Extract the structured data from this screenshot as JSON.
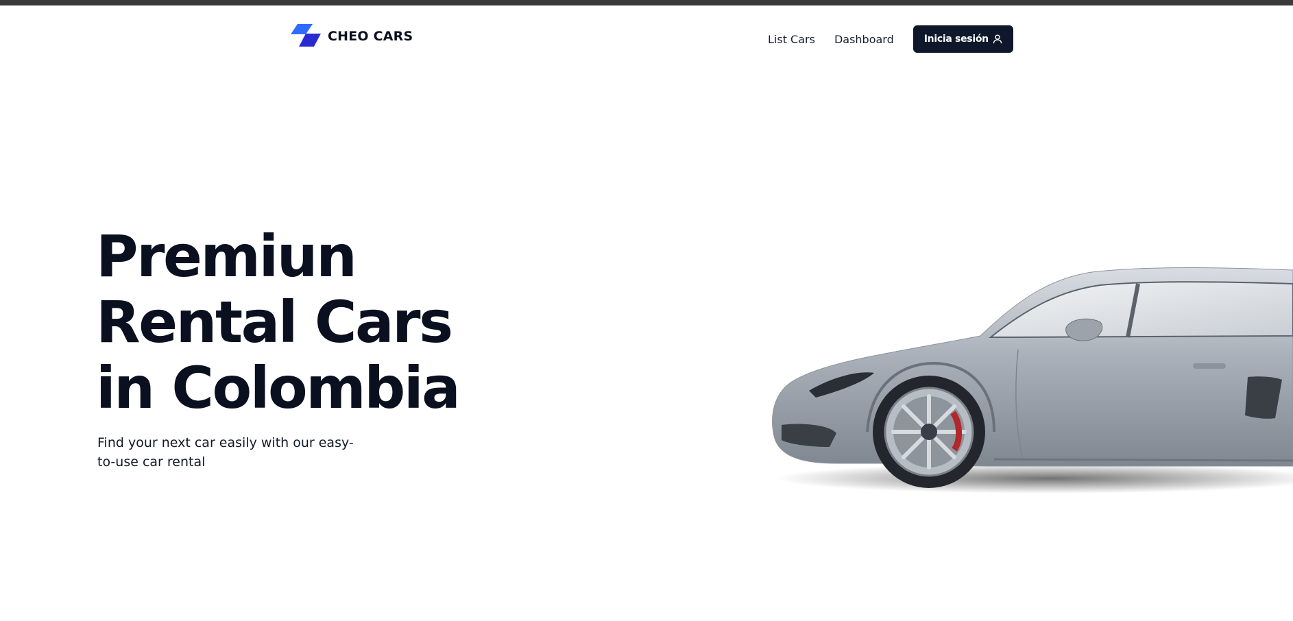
{
  "header": {
    "brand": "CHEO CARS",
    "nav": {
      "list_cars": "List Cars",
      "dashboard": "Dashboard"
    },
    "login_label": "Inicia sesión",
    "brand_colors": [
      "#2f6bff",
      "#2a2ad0"
    ]
  },
  "hero": {
    "title_lines": [
      "Premiun",
      "Rental Cars",
      "in Colombia"
    ],
    "subtitle": "Find your next car easily with our easy-to-use car rental",
    "car_image_icon": "sports-car-image"
  },
  "icons": {
    "logo": "logo-mark-icon",
    "user": "user-icon"
  }
}
